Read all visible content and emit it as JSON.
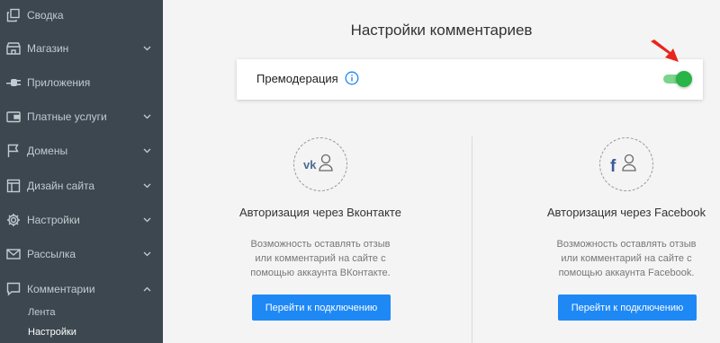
{
  "sidebar": {
    "items": [
      {
        "label": "Сводка",
        "icon": "copy-icon",
        "has_chevron": false
      },
      {
        "label": "Магазин",
        "icon": "shop-icon",
        "has_chevron": true
      },
      {
        "label": "Приложения",
        "icon": "plug-icon",
        "has_chevron": false
      },
      {
        "label": "Платные услуги",
        "icon": "wallet-icon",
        "has_chevron": true
      },
      {
        "label": "Домены",
        "icon": "flag-icon",
        "has_chevron": true
      },
      {
        "label": "Дизайн сайта",
        "icon": "layout-icon",
        "has_chevron": true
      },
      {
        "label": "Настройки",
        "icon": "gear-icon",
        "has_chevron": true
      },
      {
        "label": "Рассылка",
        "icon": "mail-icon",
        "has_chevron": true
      },
      {
        "label": "Комментарии",
        "icon": "comment-icon",
        "has_chevron": true,
        "expanded": true
      }
    ],
    "subitems": [
      {
        "label": "Лента",
        "active": false
      },
      {
        "label": "Настройки",
        "active": true
      }
    ]
  },
  "main": {
    "title": "Настройки комментариев",
    "premoderation": {
      "label": "Премодерация",
      "enabled": true
    },
    "auth": [
      {
        "network": "vk",
        "icon": "vk-icon",
        "title": "Авторизация через Вконтакте",
        "desc": [
          "Возможность оставлять отзыв",
          "или комментарий на сайте с",
          "помощью аккаунта ВКонтакте."
        ],
        "button": "Перейти к подключению"
      },
      {
        "network": "facebook",
        "icon": "facebook-icon",
        "title": "Авторизация через Facebook",
        "desc": [
          "Возможность оставлять отзыв",
          "или комментарий на сайте с",
          "помощью аккаунта Facebook."
        ],
        "button": "Перейти к подключению"
      }
    ]
  },
  "colors": {
    "sidebar_bg": "#3c474f",
    "sidebar_text": "#c4cbd0",
    "accent_blue": "#1e88f5",
    "toggle_green": "#28b446",
    "arrow_red": "#e8251c"
  }
}
